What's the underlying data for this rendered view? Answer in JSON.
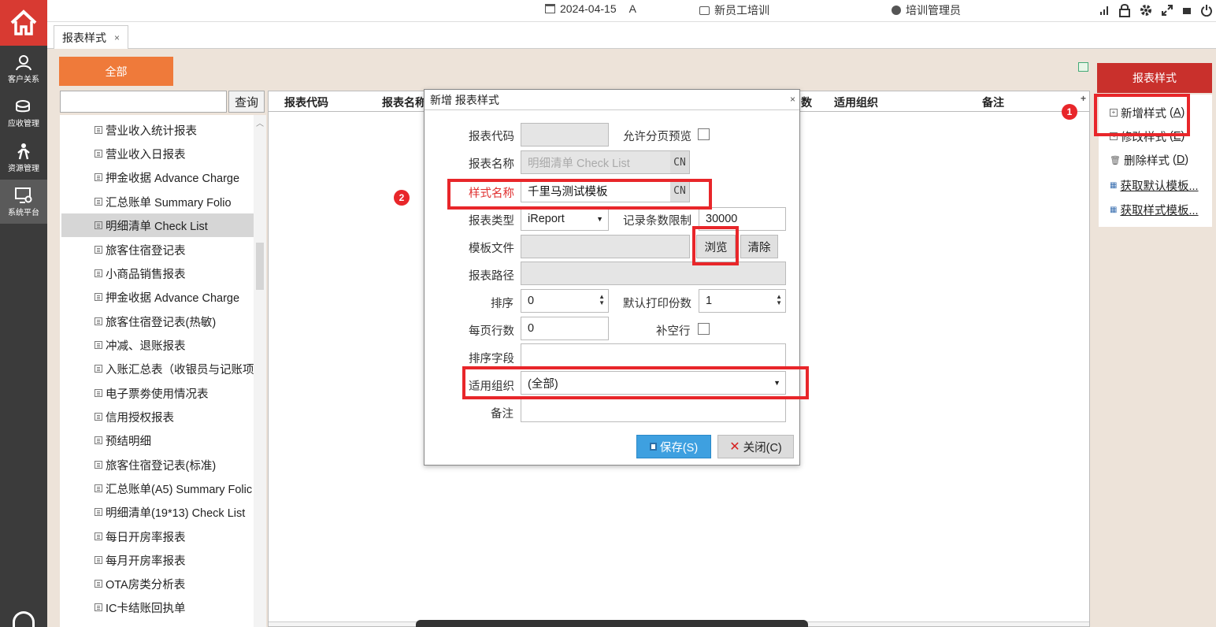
{
  "topbar": {
    "date": "2024-04-15",
    "shift": "A",
    "dept": "新员工培训",
    "user": "培训管理员"
  },
  "nav": {
    "items": [
      {
        "label": "客户关系"
      },
      {
        "label": "应收管理"
      },
      {
        "label": "资源管理"
      },
      {
        "label": "系统平台"
      }
    ]
  },
  "tab": {
    "label": "报表样式",
    "close": "×"
  },
  "filter": {
    "all_label": "全部",
    "search_btn": "查询",
    "search_value": ""
  },
  "tree": {
    "items": [
      "营业收入统计报表",
      "营业收入日报表",
      "押金收据 Advance Charge",
      "汇总账单 Summary Folio",
      "明细清单 Check List",
      "旅客住宿登记表",
      "小商品销售报表",
      "押金收据 Advance Charge",
      "旅客住宿登记表(热敏)",
      "冲减、退账报表",
      "入账汇总表（收银员与记账项.",
      "电子票劵使用情况表",
      "信用授权报表",
      "预结明细",
      "旅客住宿登记表(标准)",
      "汇总账单(A5) Summary Folic",
      "明细清单(19*13) Check List",
      "每日开房率报表",
      "每月开房率报表",
      "OTA房类分析表",
      "IC卡结账回执单"
    ],
    "selected": "明细清单 Check List"
  },
  "grid": {
    "columns": [
      "报表代码",
      "报表名称",
      "数",
      "适用组织",
      "备注"
    ],
    "add": "+"
  },
  "right_panel": {
    "title": "报表样式",
    "actions": [
      {
        "label": "新增样式",
        "key": "A"
      },
      {
        "label": "修改样式",
        "key": "E"
      },
      {
        "label": "删除样式",
        "key": "D"
      },
      {
        "label": "获取默认模板...",
        "key": ""
      },
      {
        "label": "获取样式模板...",
        "key": ""
      }
    ]
  },
  "dialog": {
    "title": "新增 报表样式",
    "close": "×",
    "fields": {
      "report_code": {
        "label": "报表代码",
        "value": ""
      },
      "allow_preview": {
        "label": "允许分页预览"
      },
      "report_name": {
        "label": "报表名称",
        "value": "明细清单  Check List",
        "lang": "CN"
      },
      "style_name": {
        "label": "样式名称",
        "value": "千里马测试模板",
        "lang": "CN"
      },
      "report_type": {
        "label": "报表类型",
        "value": "iReport"
      },
      "record_limit": {
        "label": "记录条数限制",
        "value": "30000"
      },
      "template_file": {
        "label": "模板文件",
        "value": "",
        "browse": "浏览",
        "clear": "清除"
      },
      "report_path": {
        "label": "报表路径",
        "value": ""
      },
      "sort": {
        "label": "排序",
        "value": "0"
      },
      "print_copies": {
        "label": "默认打印份数",
        "value": "1"
      },
      "rows_per_page": {
        "label": "每页行数",
        "value": "0"
      },
      "fill_empty": {
        "label": "补空行"
      },
      "sort_field": {
        "label": "排序字段",
        "value": ""
      },
      "org": {
        "label": "适用组织",
        "value": "(全部)"
      },
      "remark": {
        "label": "备注",
        "value": ""
      }
    },
    "save": "保存(S)",
    "cancel": "关闭(C)"
  },
  "annotations": {
    "badge1": "1",
    "badge2": "2"
  },
  "colors": {
    "accent_red": "#c9302c",
    "orange": "#ef7a3a",
    "highlight": "#e8262a",
    "save_blue": "#3ea0e0"
  }
}
